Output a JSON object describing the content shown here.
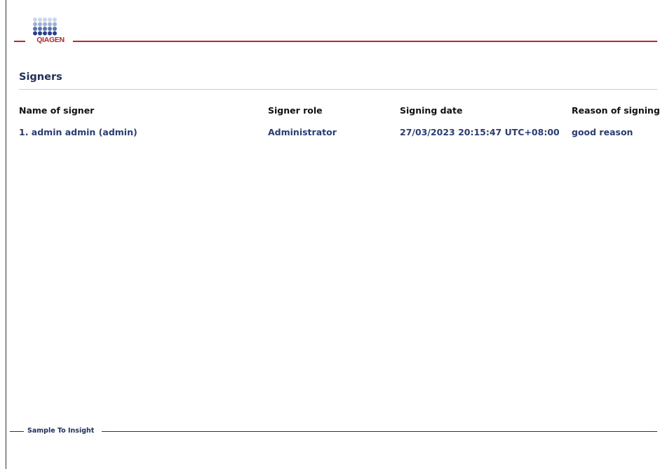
{
  "brand": {
    "logo_text": "QIAGEN",
    "accent_color": "#c0252e",
    "navy_color": "#20305e"
  },
  "section": {
    "title": "Signers"
  },
  "table": {
    "headers": [
      "Name of signer",
      "Signer role",
      "Signing date",
      "Reason of signing"
    ],
    "rows": [
      [
        "1. admin admin (admin)",
        "Administrator",
        "27/03/2023 20:15:47 UTC+08:00",
        "good reason"
      ]
    ]
  },
  "footer": {
    "tagline": "Sample To Insight"
  }
}
